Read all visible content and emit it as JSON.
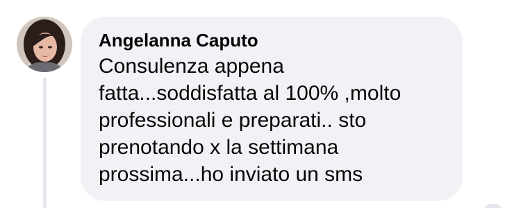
{
  "comment": {
    "author": "Angelanna Caputo",
    "text": "Consulenza appena\nfatta...soddisfatta al 100% ,molto\nprofessionali e preparati.. sto\nprenotando x la settimana\nprossima...ho inviato un sms"
  },
  "avatar": {
    "icon": "user-photo-icon"
  },
  "colors": {
    "bubble": "#f0f2f5",
    "text": "#050505",
    "thread_line": "#e4e6eb"
  }
}
